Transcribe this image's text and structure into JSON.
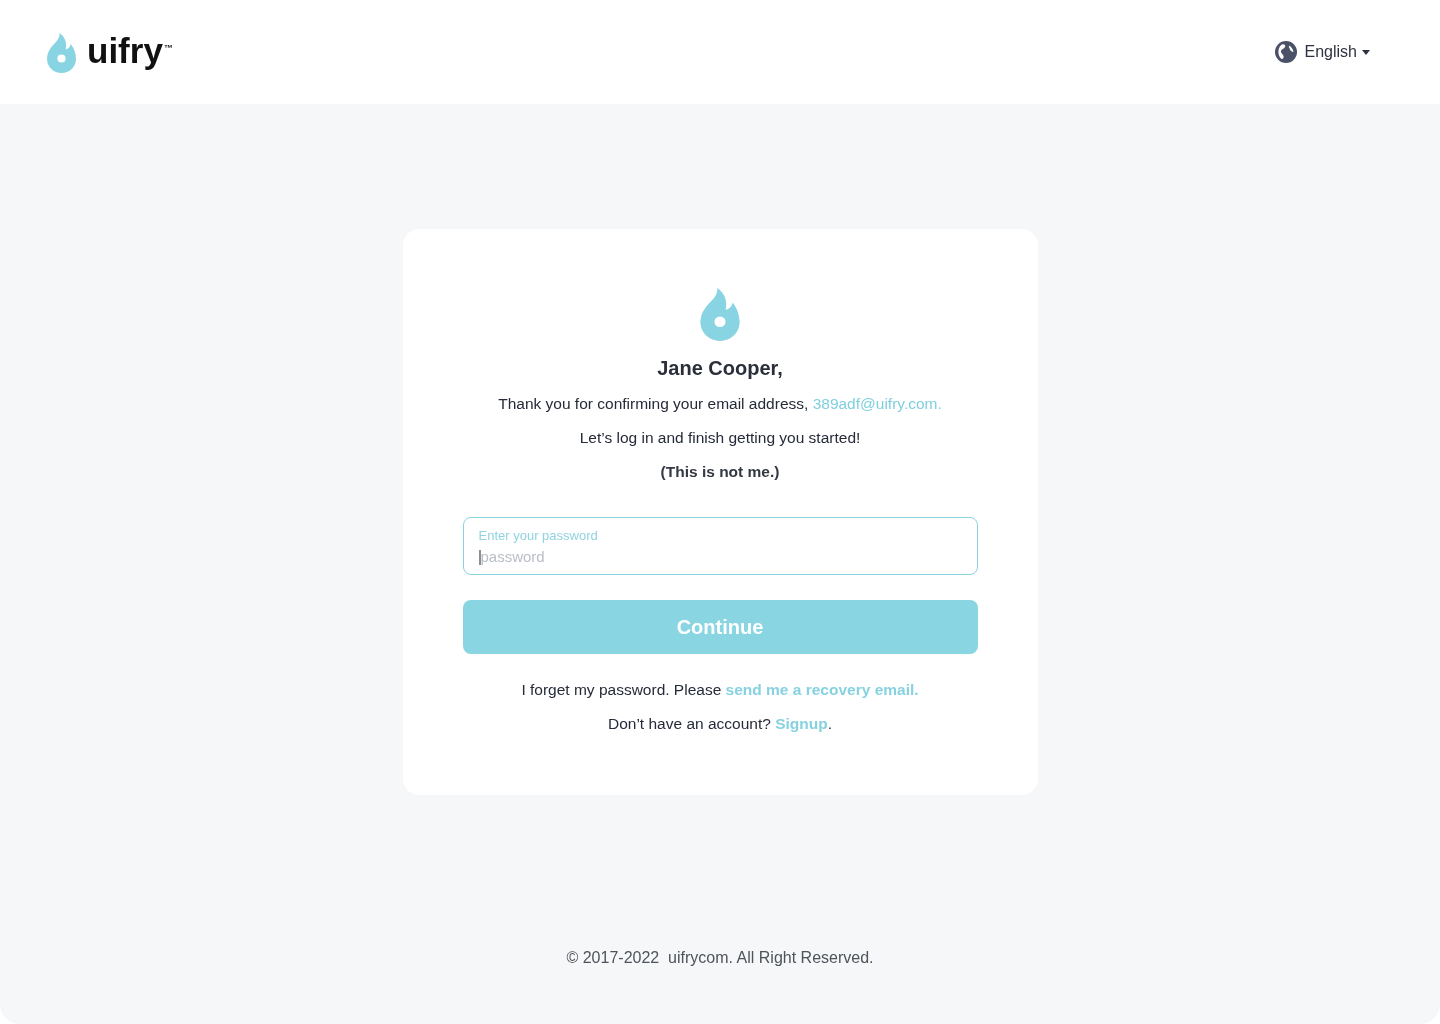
{
  "header": {
    "logo": {
      "wordmark": "uifry",
      "trademark": "™"
    },
    "language": {
      "label": "English"
    }
  },
  "card": {
    "greeting": "Jane Cooper,",
    "confirmation": {
      "text": "Thank you for confirming your email address,",
      "email": "389adf@uifry.com."
    },
    "message": "Let’s log in and finish getting you started!",
    "not_me": "(This is not me.)",
    "password_field": {
      "label": "Enter your password",
      "placeholder": "password",
      "focused": true
    },
    "continue_button": {
      "label": "Continue"
    },
    "recovery": {
      "text": "I forget my password. Please",
      "link": "send me a recovery email."
    },
    "signup": {
      "text": "Don’t have an account?",
      "link": "Signup",
      "suffix": "."
    }
  },
  "footer": {
    "copyright": "© 2017-2022  uifrycom. All Right Reserved."
  }
}
